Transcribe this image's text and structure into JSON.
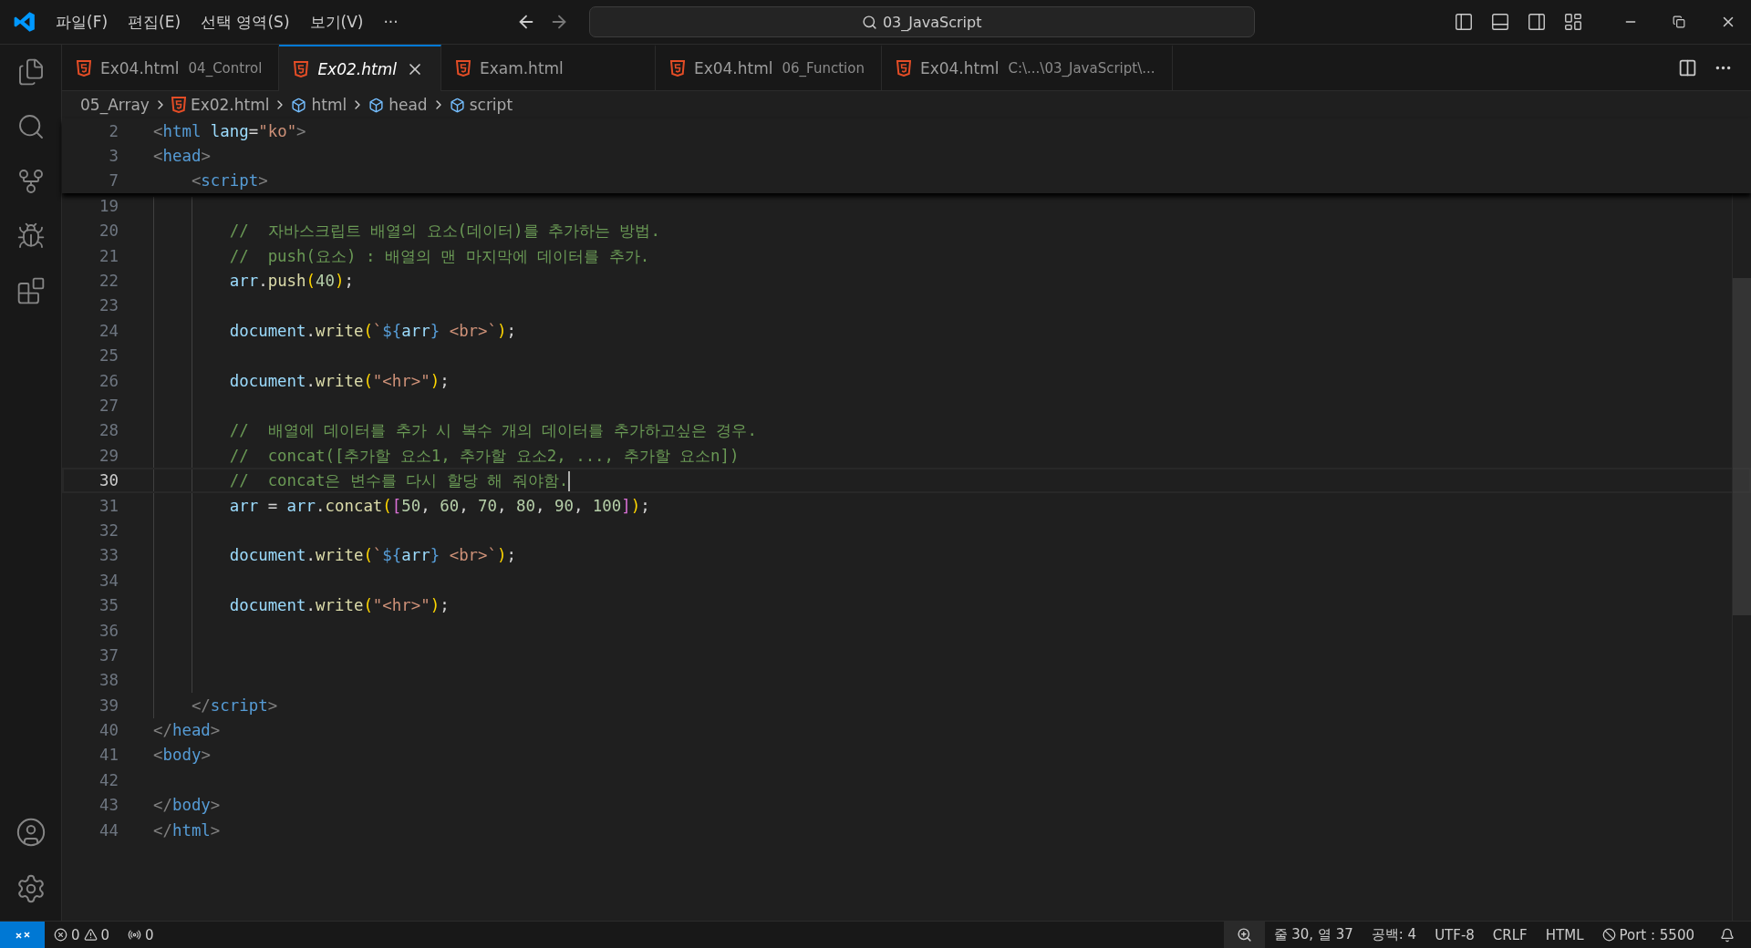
{
  "menu": [
    "파일(F)",
    "편집(E)",
    "선택 영역(S)",
    "보기(V)",
    "···"
  ],
  "search": {
    "value": "03_JavaScript"
  },
  "tabs": [
    {
      "label": "Ex04.html",
      "description": "04_Control",
      "selected": false,
      "preview": false
    },
    {
      "label": "Ex02.html",
      "selected": true,
      "preview": true
    },
    {
      "label": "Exam.html",
      "selected": false,
      "preview": false
    },
    {
      "label": "Ex04.html",
      "description": "06_Function",
      "selected": false,
      "preview": false
    },
    {
      "label": "Ex04.html",
      "description": "C:\\...\\03_JavaScript\\...",
      "selected": false,
      "preview": false
    }
  ],
  "breadcrumb": [
    {
      "kind": "folder",
      "label": "05_Array"
    },
    {
      "kind": "file",
      "label": "Ex02.html"
    },
    {
      "kind": "element",
      "label": "html"
    },
    {
      "kind": "element",
      "label": "head"
    },
    {
      "kind": "element",
      "label": "script"
    }
  ],
  "sticky_lines": [
    {
      "number": "2",
      "tokens": [
        {
          "kind": "tag",
          "text": "<"
        },
        {
          "kind": "tagname",
          "text": "html"
        },
        {
          "kind": "attr",
          "text": " lang"
        },
        {
          "kind": "plain",
          "text": "="
        },
        {
          "kind": "string",
          "text": "\"ko\""
        },
        {
          "kind": "tag",
          "text": ">"
        }
      ]
    },
    {
      "number": "3",
      "tokens": [
        {
          "kind": "tag",
          "text": "<"
        },
        {
          "kind": "tagname",
          "text": "head"
        },
        {
          "kind": "tag",
          "text": ">"
        }
      ]
    },
    {
      "number": "7",
      "tokens": [
        {
          "kind": "tag",
          "text": "    <"
        },
        {
          "kind": "tagname",
          "text": "script"
        },
        {
          "kind": "tag",
          "text": ">"
        }
      ]
    }
  ],
  "lines": [
    {
      "number": "19",
      "current": false
    },
    {
      "number": "20",
      "current": false,
      "tokens": [
        {
          "kind": "comment",
          "text": "        //  자바스크립트 배열의 요소(데이터)를 추가하는 방법."
        }
      ]
    },
    {
      "number": "21",
      "current": false,
      "tokens": [
        {
          "kind": "comment",
          "text": "        //  push(요소) : 배열의 맨 마지막에 데이터를 추가."
        }
      ]
    },
    {
      "number": "22",
      "current": false,
      "tokens": [
        {
          "kind": "var",
          "text": "        arr"
        },
        {
          "kind": "plain",
          "text": "."
        },
        {
          "kind": "func",
          "text": "push"
        },
        {
          "kind": "bracket1",
          "text": "("
        },
        {
          "kind": "number",
          "text": "40"
        },
        {
          "kind": "bracket1",
          "text": ")"
        },
        {
          "kind": "plain",
          "text": ";"
        }
      ]
    },
    {
      "number": "23",
      "current": false
    },
    {
      "number": "24",
      "current": false,
      "tokens": [
        {
          "kind": "var",
          "text": "        document"
        },
        {
          "kind": "plain",
          "text": "."
        },
        {
          "kind": "func",
          "text": "write"
        },
        {
          "kind": "bracket1",
          "text": "("
        },
        {
          "kind": "string",
          "text": "`"
        },
        {
          "kind": "keyword",
          "text": "${"
        },
        {
          "kind": "var",
          "text": "arr"
        },
        {
          "kind": "keyword",
          "text": "}"
        },
        {
          "kind": "string",
          "text": " <br>`"
        },
        {
          "kind": "bracket1",
          "text": ")"
        },
        {
          "kind": "plain",
          "text": ";"
        }
      ]
    },
    {
      "number": "25",
      "current": false
    },
    {
      "number": "26",
      "current": false,
      "tokens": [
        {
          "kind": "var",
          "text": "        document"
        },
        {
          "kind": "plain",
          "text": "."
        },
        {
          "kind": "func",
          "text": "write"
        },
        {
          "kind": "bracket1",
          "text": "("
        },
        {
          "kind": "string",
          "text": "\"<hr>\""
        },
        {
          "kind": "bracket1",
          "text": ")"
        },
        {
          "kind": "plain",
          "text": ";"
        }
      ]
    },
    {
      "number": "27",
      "current": false
    },
    {
      "number": "28",
      "current": false,
      "tokens": [
        {
          "kind": "comment",
          "text": "        //  배열에 데이터를 추가 시 복수 개의 데이터를 추가하고싶은 경우."
        }
      ]
    },
    {
      "number": "29",
      "current": false,
      "tokens": [
        {
          "kind": "comment",
          "text": "        //  concat([추가할 요소1, 추가할 요소2, ..., 추가할 요소n])"
        }
      ]
    },
    {
      "number": "30",
      "current": true,
      "tokens": [
        {
          "kind": "comment",
          "text": "        //  concat은 변수를 다시 할당 해 줘야함."
        }
      ]
    },
    {
      "number": "31",
      "current": false,
      "tokens": [
        {
          "kind": "var",
          "text": "        arr"
        },
        {
          "kind": "plain",
          "text": " = "
        },
        {
          "kind": "var",
          "text": "arr"
        },
        {
          "kind": "plain",
          "text": "."
        },
        {
          "kind": "func",
          "text": "concat"
        },
        {
          "kind": "bracket1",
          "text": "("
        },
        {
          "kind": "bracket2",
          "text": "["
        },
        {
          "kind": "number",
          "text": "50"
        },
        {
          "kind": "plain",
          "text": ", "
        },
        {
          "kind": "number",
          "text": "60"
        },
        {
          "kind": "plain",
          "text": ", "
        },
        {
          "kind": "number",
          "text": "70"
        },
        {
          "kind": "plain",
          "text": ", "
        },
        {
          "kind": "number",
          "text": "80"
        },
        {
          "kind": "plain",
          "text": ", "
        },
        {
          "kind": "number",
          "text": "90"
        },
        {
          "kind": "plain",
          "text": ", "
        },
        {
          "kind": "number",
          "text": "100"
        },
        {
          "kind": "bracket2",
          "text": "]"
        },
        {
          "kind": "bracket1",
          "text": ")"
        },
        {
          "kind": "plain",
          "text": ";"
        }
      ]
    },
    {
      "number": "32",
      "current": false
    },
    {
      "number": "33",
      "current": false,
      "tokens": [
        {
          "kind": "var",
          "text": "        document"
        },
        {
          "kind": "plain",
          "text": "."
        },
        {
          "kind": "func",
          "text": "write"
        },
        {
          "kind": "bracket1",
          "text": "("
        },
        {
          "kind": "string",
          "text": "`"
        },
        {
          "kind": "keyword",
          "text": "${"
        },
        {
          "kind": "var",
          "text": "arr"
        },
        {
          "kind": "keyword",
          "text": "}"
        },
        {
          "kind": "string",
          "text": " <br>`"
        },
        {
          "kind": "bracket1",
          "text": ")"
        },
        {
          "kind": "plain",
          "text": ";"
        }
      ]
    },
    {
      "number": "34",
      "current": false
    },
    {
      "number": "35",
      "current": false,
      "tokens": [
        {
          "kind": "var",
          "text": "        document"
        },
        {
          "kind": "plain",
          "text": "."
        },
        {
          "kind": "func",
          "text": "write"
        },
        {
          "kind": "bracket1",
          "text": "("
        },
        {
          "kind": "string",
          "text": "\"<hr>\""
        },
        {
          "kind": "bracket1",
          "text": ")"
        },
        {
          "kind": "plain",
          "text": ";"
        }
      ]
    },
    {
      "number": "36",
      "current": false
    },
    {
      "number": "37",
      "current": false
    },
    {
      "number": "38",
      "current": false
    },
    {
      "number": "39",
      "current": false,
      "tokens": [
        {
          "kind": "tag",
          "text": "    </"
        },
        {
          "kind": "tagname",
          "text": "script"
        },
        {
          "kind": "tag",
          "text": ">"
        }
      ]
    },
    {
      "number": "40",
      "current": false,
      "tokens": [
        {
          "kind": "tag",
          "text": "</"
        },
        {
          "kind": "tagname",
          "text": "head"
        },
        {
          "kind": "tag",
          "text": ">"
        }
      ]
    },
    {
      "number": "41",
      "current": false,
      "tokens": [
        {
          "kind": "tag",
          "text": "<"
        },
        {
          "kind": "tagname",
          "text": "body"
        },
        {
          "kind": "tag",
          "text": ">"
        }
      ]
    },
    {
      "number": "42",
      "current": false
    },
    {
      "number": "43",
      "current": false,
      "tokens": [
        {
          "kind": "tag",
          "text": "</"
        },
        {
          "kind": "tagname",
          "text": "body"
        },
        {
          "kind": "tag",
          "text": ">"
        }
      ]
    },
    {
      "number": "44",
      "current": false,
      "tokens": [
        {
          "kind": "tag",
          "text": "</"
        },
        {
          "kind": "tagname",
          "text": "html"
        },
        {
          "kind": "tag",
          "text": ">"
        }
      ]
    }
  ],
  "status": {
    "errors": "0",
    "warnings": "0",
    "ports": "0",
    "position": "줄 30, 열 37",
    "indent": "공백: 4",
    "encoding": "UTF-8",
    "eol": "CRLF",
    "language": "HTML",
    "server": "Port : 5500"
  }
}
